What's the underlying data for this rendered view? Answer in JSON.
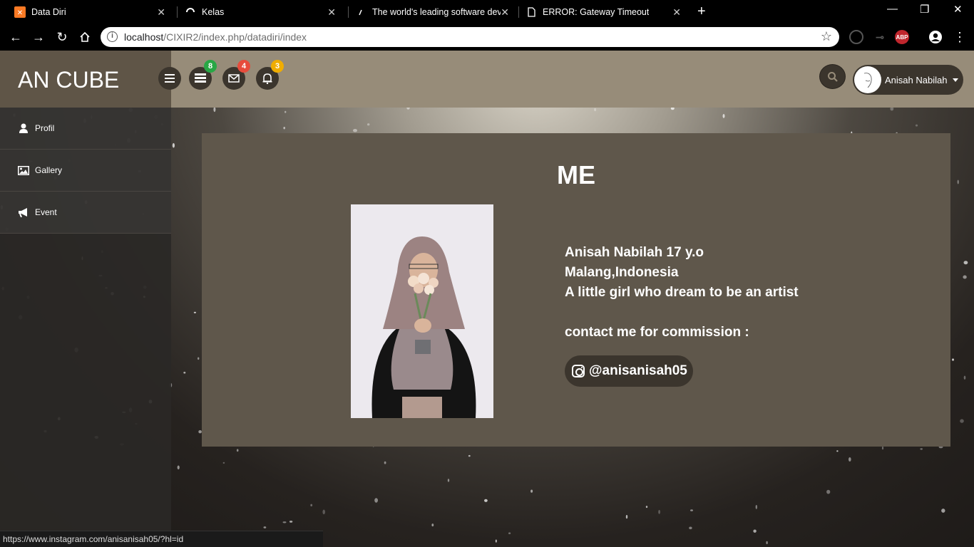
{
  "browser": {
    "tabs": [
      {
        "title": "Data Diri",
        "icon": "xampp-icon"
      },
      {
        "title": "Kelas",
        "icon": "loading-spinner-icon"
      },
      {
        "title": "The world's leading software dev",
        "icon": "site-icon"
      },
      {
        "title": "ERROR: Gateway Timeout",
        "icon": "document-icon"
      }
    ],
    "url_host": "localhost",
    "url_path": "/CIXIR2/index.php/datadiri/index",
    "extensions": [
      "extension-icon",
      "extension-icon",
      "abp-icon",
      "profile-icon"
    ],
    "abp_label": "ABP"
  },
  "header": {
    "brand": "AN CUBE",
    "badges": {
      "tasks": "8",
      "messages": "4",
      "notifications": "3"
    },
    "badge_colors": {
      "tasks": "#28a745",
      "messages": "#e74c3c",
      "notifications": "#f0ad00"
    },
    "user_name": "Anisah Nabilah"
  },
  "sidebar": {
    "items": [
      {
        "label": "Profil",
        "icon": "user-icon"
      },
      {
        "label": "Gallery",
        "icon": "image-icon"
      },
      {
        "label": "Event",
        "icon": "megaphone-icon"
      }
    ]
  },
  "main": {
    "heading": "ME",
    "info_lines": [
      "Anisah Nabilah 17 y.o",
      "Malang,Indonesia",
      "A little girl who dream to be an artist",
      "",
      "contact me for commission :"
    ],
    "instagram_handle": "@anisanisah05"
  },
  "status_url": "https://www.instagram.com/anisanisah05/?hl=id"
}
